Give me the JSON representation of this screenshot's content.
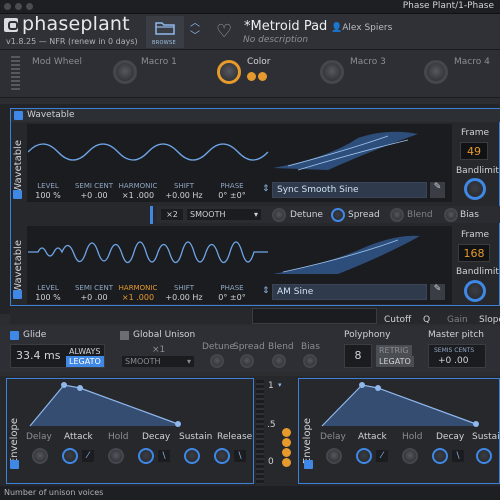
{
  "window_title": "Phase Plant/1-Phase",
  "app": {
    "logo": "phaseplant",
    "version": "v1.8.25 — NFR (renew in 0 days)"
  },
  "header": {
    "browse_label": "BROWSE",
    "patch_name": "*Metroid Pad",
    "author": "Alex Spiers",
    "description": "No description"
  },
  "macros": {
    "mod_wheel": "Mod Wheel",
    "macro1": "Macro 1",
    "color": "Color",
    "macro3": "Macro 3",
    "macro4": "Macro 4"
  },
  "module": {
    "title": "Wavetable"
  },
  "osc1": {
    "side_label": "Wavetable",
    "params": [
      {
        "label": "LEVEL",
        "value": "100 %"
      },
      {
        "label": "SEMI CENT",
        "value": "+0 .00"
      },
      {
        "label": "HARMONIC",
        "value": "×1 .000"
      },
      {
        "label": "SHIFT",
        "value": "+0.00 Hz"
      },
      {
        "label": "PHASE",
        "value": "0° ±0°"
      }
    ],
    "wavetable": "Sync Smooth Sine",
    "frame_label": "Frame",
    "frame": "49",
    "bandlimit_label": "Bandlimit"
  },
  "midrow": {
    "unison": "×2",
    "mode": "SMOOTH",
    "detune": "Detune",
    "spread": "Spread",
    "blend": "Blend",
    "bias": "Bias"
  },
  "osc2": {
    "side_label": "Wavetable",
    "params": [
      {
        "label": "LEVEL",
        "value": "100 %"
      },
      {
        "label": "SEMI CENT",
        "value": "+0 .00"
      },
      {
        "label": "HARMONIC",
        "value": "×1 .000"
      },
      {
        "label": "SHIFT",
        "value": "+0.00 Hz"
      },
      {
        "label": "PHASE",
        "value": "0° ±0°"
      }
    ],
    "wavetable": "AM Sine",
    "frame_label": "Frame",
    "frame": "168",
    "bandlimit_label": "Bandlimit"
  },
  "filter": {
    "cutoff": "Cutoff",
    "q": "Q",
    "gain": "Gain",
    "slope": "Slope"
  },
  "glide": {
    "label": "Glide",
    "value": "33.4 ms",
    "always": "ALWAYS",
    "legato": "LEGATO"
  },
  "global_unison": {
    "label": "Global Unison",
    "voices": "×1",
    "mode": "SMOOTH",
    "detune": "Detune",
    "spread": "Spread",
    "blend": "Blend",
    "bias": "Bias"
  },
  "polyphony": {
    "label": "Polyphony",
    "value": "8",
    "retrig": "RETRIG",
    "legato": "LEGATO"
  },
  "master_pitch": {
    "label": "Master pitch",
    "sub": "SEMIS CENTS",
    "value": "+0 .00"
  },
  "envelope1": {
    "side_label": "Envelope",
    "params": [
      "Delay",
      "Attack",
      "Hold",
      "Decay",
      "Sustain",
      "Release"
    ]
  },
  "envelope2": {
    "side_label": "Envelope",
    "params": [
      "Delay",
      "Attack",
      "Hold",
      "Decay",
      "Sustain"
    ]
  },
  "scale": {
    "top": "1",
    "mid": ".5",
    "bottom": "0"
  },
  "status": "Number of unison voices",
  "colors": {
    "accent": "#3f88e6",
    "orange": "#e69a2e",
    "background": "#2b2d31"
  }
}
